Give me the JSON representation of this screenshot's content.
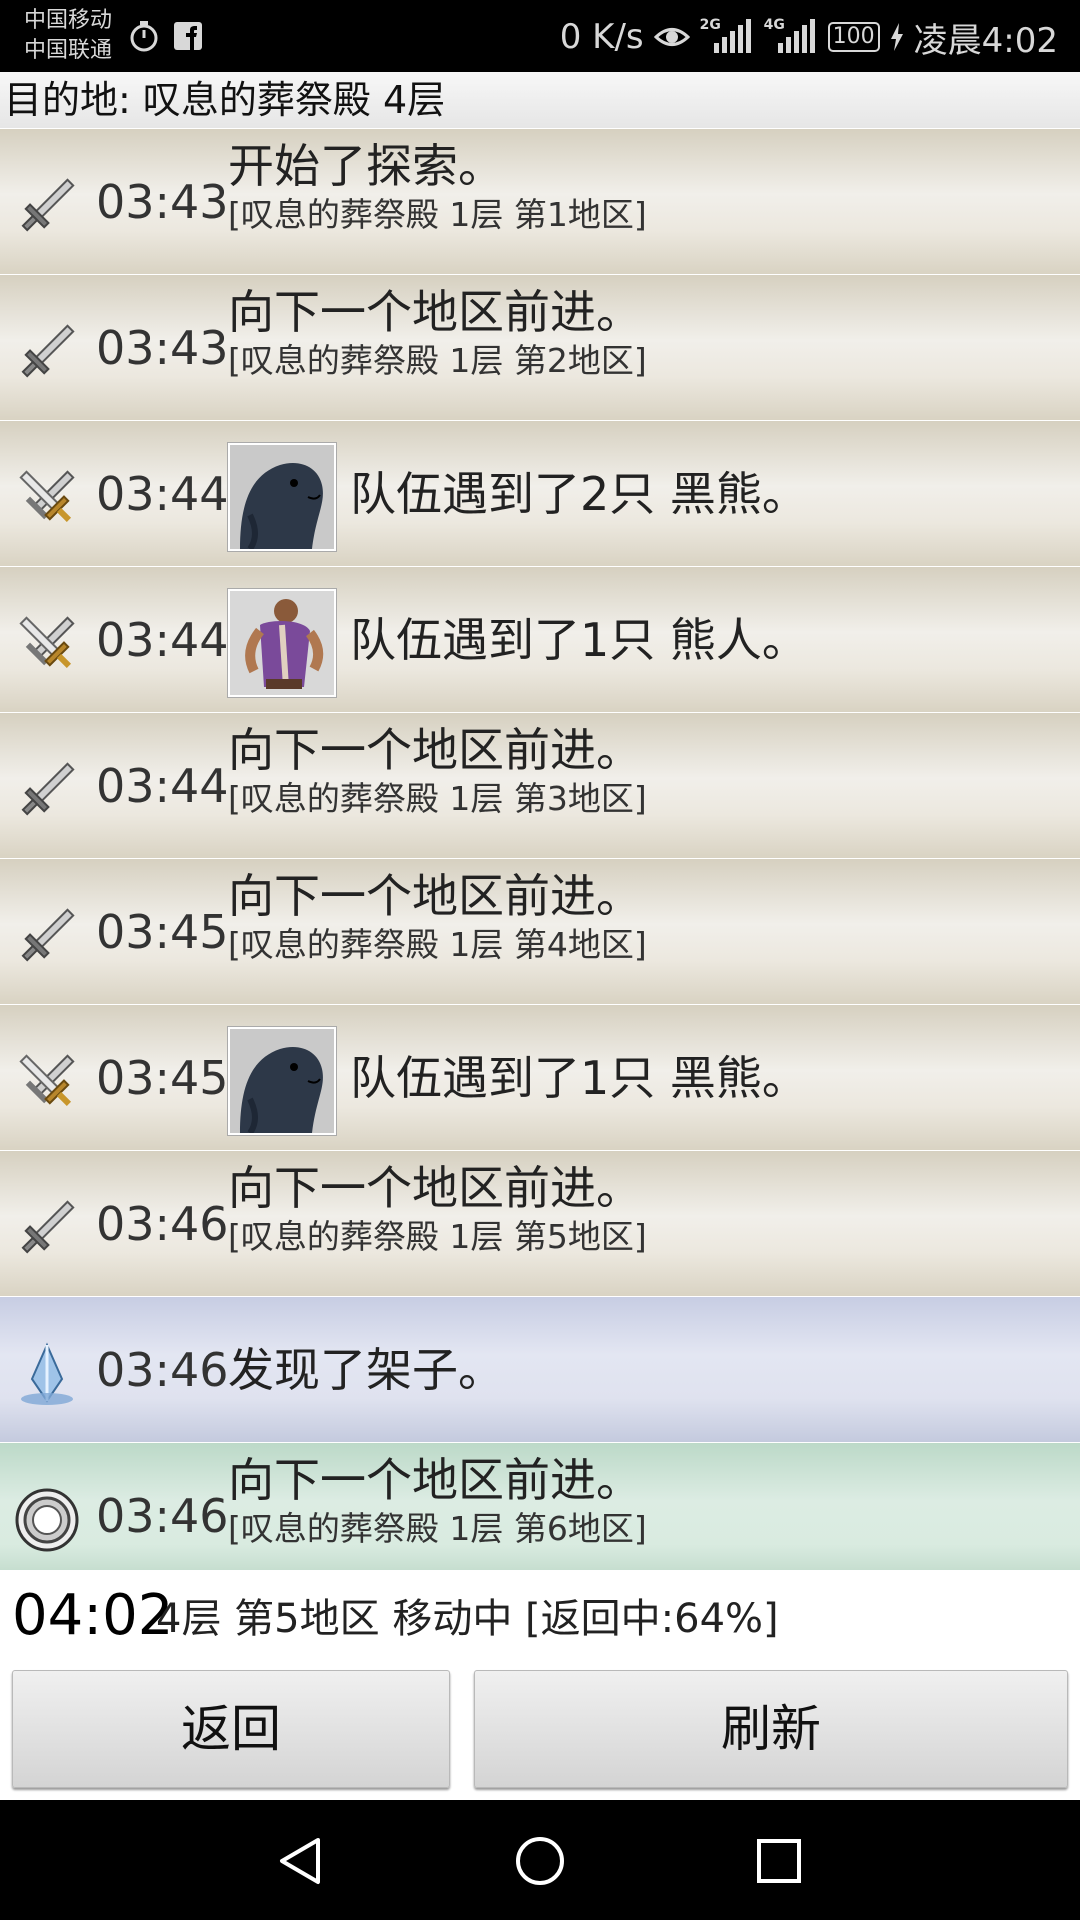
{
  "status_bar": {
    "carrier_1": "中国移动",
    "carrier_2": "中国联通",
    "net_speed": "0 K/s",
    "sig1_label": "2G",
    "sig2_label": "4G",
    "battery": "100",
    "time": "凌晨4:02"
  },
  "destination": "目的地: 叹息的葬祭殿 4层",
  "log": [
    {
      "icon": "sword-icon",
      "time": "03:43",
      "text": "开始了探索。",
      "sub": "[叹息的葬祭殿 1层 第1地区]",
      "style": "normal"
    },
    {
      "icon": "sword-icon",
      "time": "03:43",
      "text": "向下一个地区前进。",
      "sub": "[叹息的葬祭殿 1层 第2地区]",
      "style": "normal"
    },
    {
      "icon": "crossed-swords-icon",
      "time": "03:44",
      "text": "队伍遇到了2只 黑熊。",
      "avatar": "black-bear-avatar",
      "style": "normal"
    },
    {
      "icon": "crossed-swords-icon",
      "time": "03:44",
      "text": "队伍遇到了1只 熊人。",
      "avatar": "bearman-avatar",
      "style": "normal"
    },
    {
      "icon": "sword-icon",
      "time": "03:44",
      "text": "向下一个地区前进。",
      "sub": "[叹息的葬祭殿 1层 第3地区]",
      "style": "normal"
    },
    {
      "icon": "sword-icon",
      "time": "03:45",
      "text": "向下一个地区前进。",
      "sub": "[叹息的葬祭殿 1层 第4地区]",
      "style": "normal"
    },
    {
      "icon": "crossed-swords-icon",
      "time": "03:45",
      "text": "队伍遇到了1只 黑熊。",
      "avatar": "black-bear-avatar",
      "style": "normal"
    },
    {
      "icon": "sword-icon",
      "time": "03:46",
      "text": "向下一个地区前进。",
      "sub": "[叹息的葬祭殿 1层 第5地区]",
      "style": "normal"
    },
    {
      "icon": "crystal-icon",
      "time": "03:46",
      "text": "发现了架子。",
      "style": "blue"
    },
    {
      "icon": "portal-ring-icon",
      "time": "03:46",
      "text": "向下一个地区前进。",
      "sub": "[叹息的葬祭殿 1层 第6地区]",
      "style": "green"
    }
  ],
  "footer": {
    "time": "04:02",
    "status": "4层 第5地区 移动中 [返回中:64%]",
    "return_progress": 0.64,
    "back_label": "返回",
    "refresh_label": "刷新"
  },
  "colors": {
    "normal_row": "#ece8df",
    "blue_row": "#dfe2ef",
    "green_row": "#d9ebe0"
  }
}
